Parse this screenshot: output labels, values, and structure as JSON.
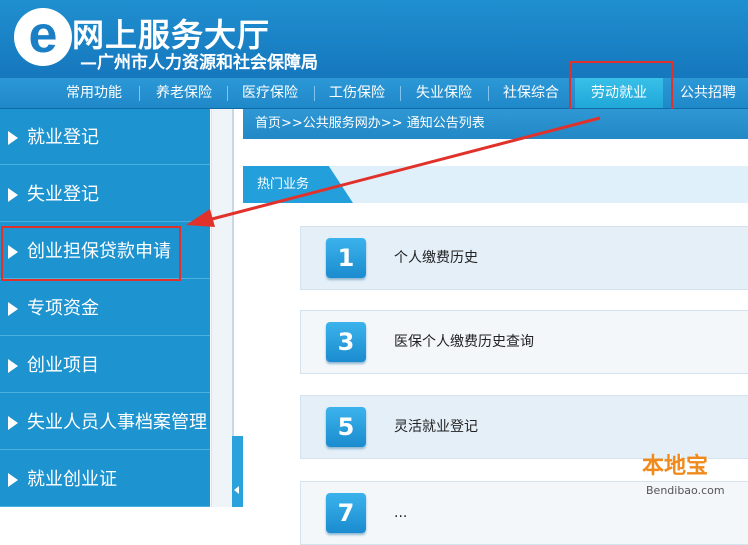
{
  "header": {
    "logo_letter": "e",
    "title": "网上服务大厅",
    "subtitle": "—广州市人力资源和社会保障局"
  },
  "nav": {
    "items": [
      "常用功能",
      "养老保险",
      "医疗保险",
      "工伤保险",
      "失业保险",
      "社保综合",
      "劳动就业",
      "公共招聘"
    ],
    "active": "劳动就业"
  },
  "sidebar": {
    "items": [
      "就业登记",
      "失业登记",
      "创业担保贷款申请",
      "专项资金",
      "创业项目",
      "失业人员人事档案管理",
      "就业创业证"
    ],
    "highlighted": "创业担保贷款申请"
  },
  "breadcrumb": "首页>>公共服务网办>> 通知公告列表",
  "hot_section": {
    "title": "热门业务",
    "items": [
      {
        "number": "1",
        "label": "个人缴费历史"
      },
      {
        "number": "3",
        "label": "医保个人缴费历史查询"
      },
      {
        "number": "5",
        "label": "灵活就业登记"
      },
      {
        "number": "7",
        "label": "..."
      }
    ]
  },
  "watermark": {
    "text": "本地宝",
    "url": "Bendibao.com"
  },
  "colors": {
    "accent": "#1d93cf",
    "highlight": "#e0322b",
    "active_tab": "#2fb5e2"
  }
}
